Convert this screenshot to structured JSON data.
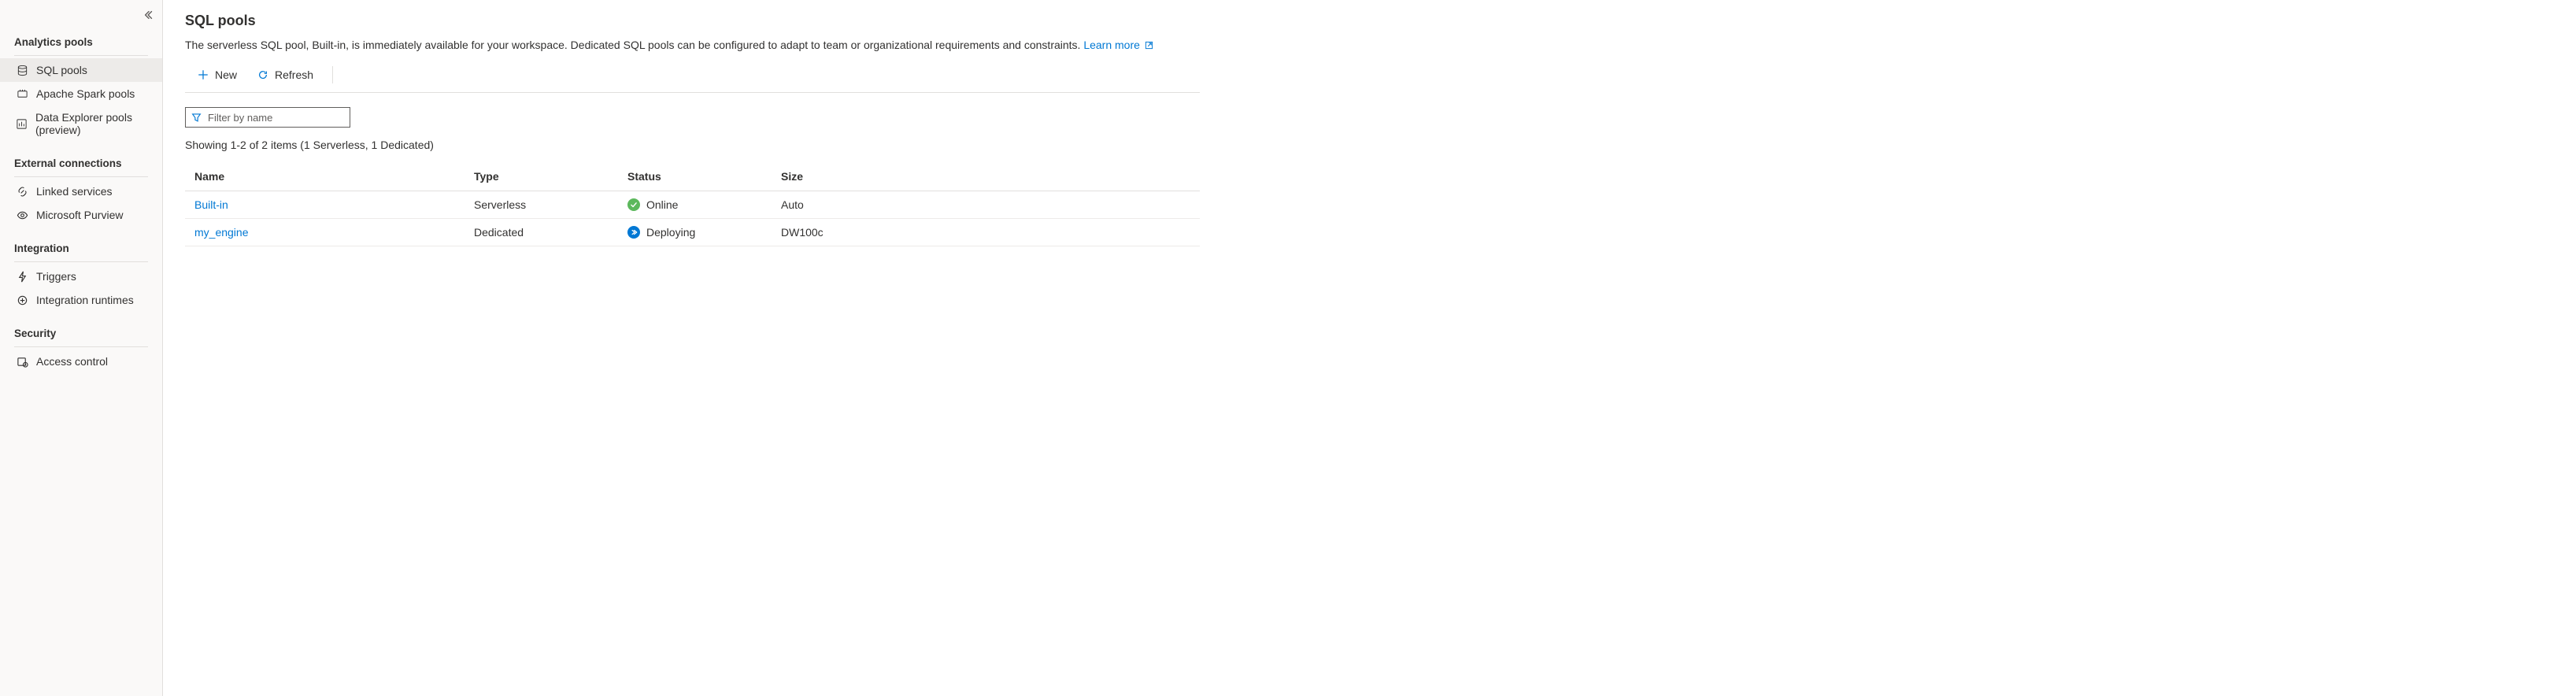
{
  "sidebar": {
    "sections": [
      {
        "title": "Analytics pools",
        "items": [
          {
            "label": "SQL pools",
            "active": true
          },
          {
            "label": "Apache Spark pools"
          },
          {
            "label": "Data Explorer pools (preview)"
          }
        ]
      },
      {
        "title": "External connections",
        "items": [
          {
            "label": "Linked services"
          },
          {
            "label": "Microsoft Purview"
          }
        ]
      },
      {
        "title": "Integration",
        "items": [
          {
            "label": "Triggers"
          },
          {
            "label": "Integration runtimes"
          }
        ]
      },
      {
        "title": "Security",
        "items": [
          {
            "label": "Access control"
          }
        ]
      }
    ]
  },
  "page": {
    "title": "SQL pools",
    "description": "The serverless SQL pool, Built-in, is immediately available for your workspace. Dedicated SQL pools can be configured to adapt to team or organizational requirements and constraints. ",
    "learn_more": "Learn more"
  },
  "toolbar": {
    "new_label": "New",
    "refresh_label": "Refresh"
  },
  "filter": {
    "placeholder": "Filter by name",
    "value": ""
  },
  "count_line": "Showing 1-2 of 2 items (1 Serverless, 1 Dedicated)",
  "table": {
    "headers": {
      "name": "Name",
      "type": "Type",
      "status": "Status",
      "size": "Size"
    },
    "rows": [
      {
        "name": "Built-in",
        "type": "Serverless",
        "status": "Online",
        "status_kind": "online",
        "size": "Auto"
      },
      {
        "name": "my_engine",
        "type": "Dedicated",
        "status": "Deploying",
        "status_kind": "deploying",
        "size": "DW100c"
      }
    ]
  }
}
